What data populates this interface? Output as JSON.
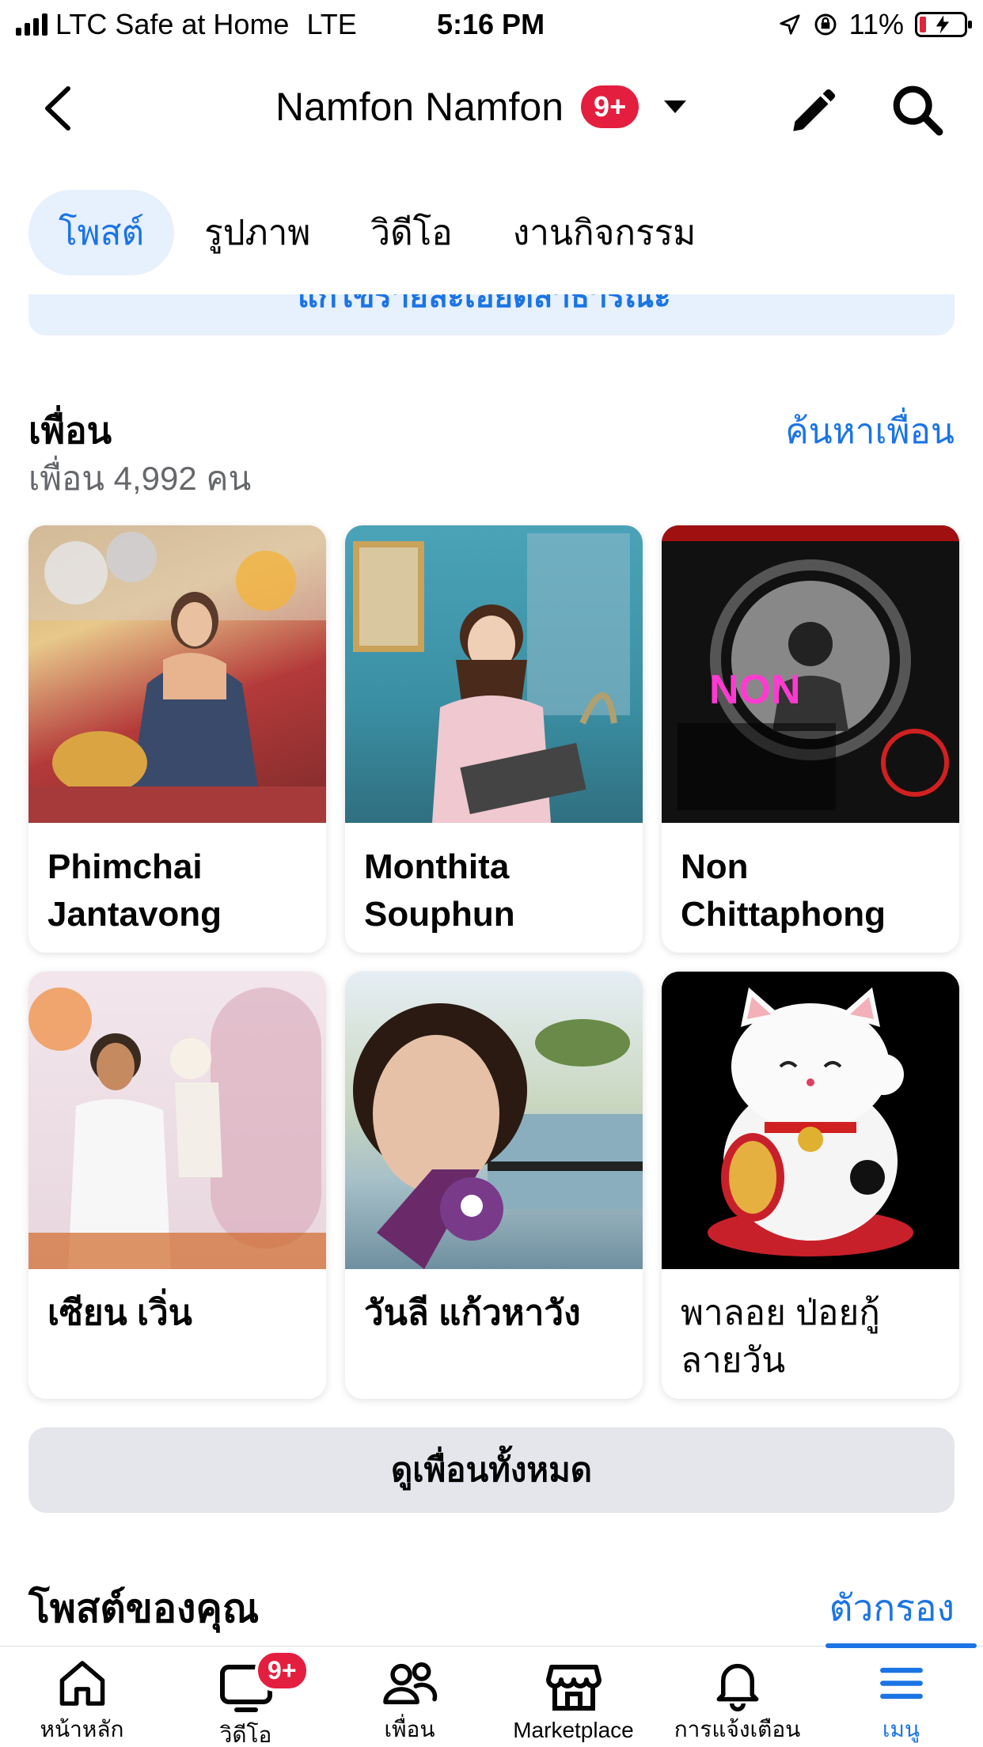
{
  "status_bar": {
    "carrier": "LTC Safe at Home",
    "network": "LTE",
    "time": "5:16 PM",
    "battery": "11%",
    "battery_level": 0.11
  },
  "header": {
    "title": "Namfon Namfon",
    "badge": "9+"
  },
  "tabs": [
    {
      "label": "โพสต์",
      "active": true
    },
    {
      "label": "รูปภาพ",
      "active": false
    },
    {
      "label": "วิดีโอ",
      "active": false
    },
    {
      "label": "งานกิจกรรม",
      "active": false
    }
  ],
  "notice": {
    "text": "แก้ไขรายละเอียดสาธารณะ"
  },
  "friends": {
    "title": "เพื่อน",
    "count_text": "เพื่อน 4,992 คน",
    "find_label": "ค้นหาเพื่อน",
    "items": [
      {
        "name": "Phimchai Jantavong"
      },
      {
        "name": "Monthita Souphun"
      },
      {
        "name": "Non Chittaphong"
      },
      {
        "name": "เซียน เวิ่น"
      },
      {
        "name": "วันลี แก้วหาวัง"
      },
      {
        "name": "พาลอย ป่อยกู้ ลายวัน"
      }
    ],
    "see_all_label": "ดูเพื่อนทั้งหมด"
  },
  "posts": {
    "title": "โพสต์ของคุณ",
    "filter_label": "ตัวกรอง"
  },
  "bottom_nav": {
    "items": [
      {
        "label": "หน้าหลัก",
        "icon": "home-icon"
      },
      {
        "label": "วิดีโอ",
        "icon": "video-icon",
        "badge": "9+"
      },
      {
        "label": "เพื่อน",
        "icon": "friends-icon"
      },
      {
        "label": "Marketplace",
        "icon": "marketplace-icon"
      },
      {
        "label": "การแจ้งเตือน",
        "icon": "bell-icon"
      },
      {
        "label": "เมนู",
        "icon": "menu-icon",
        "active": true
      }
    ]
  },
  "colors": {
    "accent": "#1b74e4",
    "badge": "#e41e3f",
    "tab_active_bg": "#e7f0fd"
  }
}
